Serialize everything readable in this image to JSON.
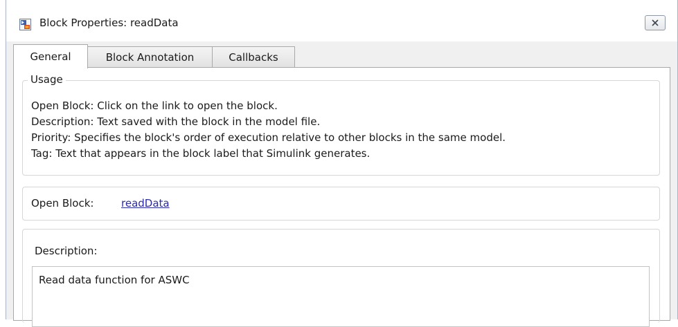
{
  "window": {
    "title": "Block Properties: readData",
    "close_icon": "close-x-icon",
    "app_icon": "simulink-block-icon"
  },
  "tabs": [
    {
      "label": "General",
      "active": true
    },
    {
      "label": "Block Annotation",
      "active": false
    },
    {
      "label": "Callbacks",
      "active": false
    }
  ],
  "usage": {
    "legend": "Usage",
    "lines": [
      "Open Block: Click on the link to open the block.",
      "Description: Text saved with the block in the model file.",
      "Priority: Specifies the block's order of execution relative to other blocks in the same model.",
      "Tag: Text that appears in the block label that Simulink generates."
    ]
  },
  "open_block": {
    "label": "Open Block:",
    "link": "readData"
  },
  "description": {
    "label": "Description:",
    "value": "Read data function for ASWC"
  },
  "colors": {
    "link": "#2b2ba8",
    "panel_bg": "#f0f0f0",
    "border": "#a8a8a8"
  }
}
